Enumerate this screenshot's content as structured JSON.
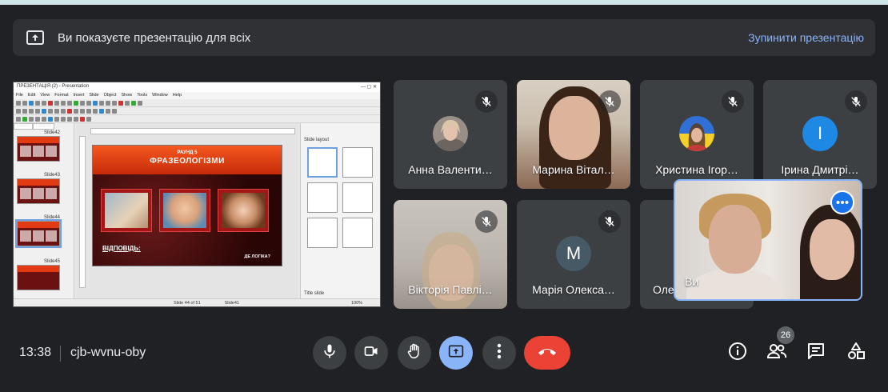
{
  "banner": {
    "text": "Ви показуєте презентацію для всіх",
    "stop_label": "Зупинити презентацію",
    "icon": "present-to-all-icon"
  },
  "shared_screen": {
    "window_title": "ПРЕЗЕНТАЦІЯ (2) - Presentation",
    "menu": [
      "File",
      "Edit",
      "View",
      "Format",
      "Insert",
      "Slide",
      "Object",
      "Show",
      "Tools",
      "Window",
      "Help"
    ],
    "slides_tabs": [
      "Slides",
      "Outline"
    ],
    "thumbnails": [
      "Slide42",
      "Slide43",
      "Slide44",
      "Slide45"
    ],
    "slide": {
      "round": "РАУНД 5",
      "title": "ФРАЗЕОЛОГІЗМИ",
      "answer_label": "ВІДПОВІДЬ:",
      "corner_text": "ДЕ ЛОГІКА?"
    },
    "layout_panel_title": "Slide layout",
    "layout_footer": "Title slide",
    "status_slide": "Slide 44 of 51",
    "status_master": "Slide41",
    "zoom": "100%"
  },
  "participants": [
    {
      "name": "Анна Валенти…",
      "muted": true,
      "type": "photo-avatar"
    },
    {
      "name": "Марина Вітал…",
      "muted": true,
      "type": "camera"
    },
    {
      "name": "Христина Ігор…",
      "muted": true,
      "type": "photo-avatar"
    },
    {
      "name": "Ірина Дмитрі…",
      "muted": true,
      "type": "letter",
      "letter": "І",
      "color": "#1e88e5"
    },
    {
      "name": "Вікторія Павлі…",
      "muted": true,
      "type": "camera"
    },
    {
      "name": "Марія Олекса…",
      "muted": true,
      "type": "letter",
      "letter": "М",
      "color": "#455a64"
    },
    {
      "name": "Оле",
      "muted": false,
      "type": "hidden"
    }
  ],
  "self_view": {
    "name": "Ви",
    "more_icon": "more-options-icon"
  },
  "bottom_bar": {
    "time": "13:38",
    "meeting_code": "cjb-wvnu-oby",
    "people_count": "26",
    "controls": [
      "microphone-icon",
      "camera-icon",
      "raise-hand-icon",
      "present-icon",
      "more-vert-icon",
      "hang-up-icon"
    ],
    "right_icons": [
      "info-icon",
      "people-icon",
      "chat-icon",
      "activities-icon"
    ]
  },
  "colors": {
    "background": "#202124",
    "tile": "#3c4043",
    "accent": "#8ab4f8",
    "hangup": "#ea4335"
  }
}
